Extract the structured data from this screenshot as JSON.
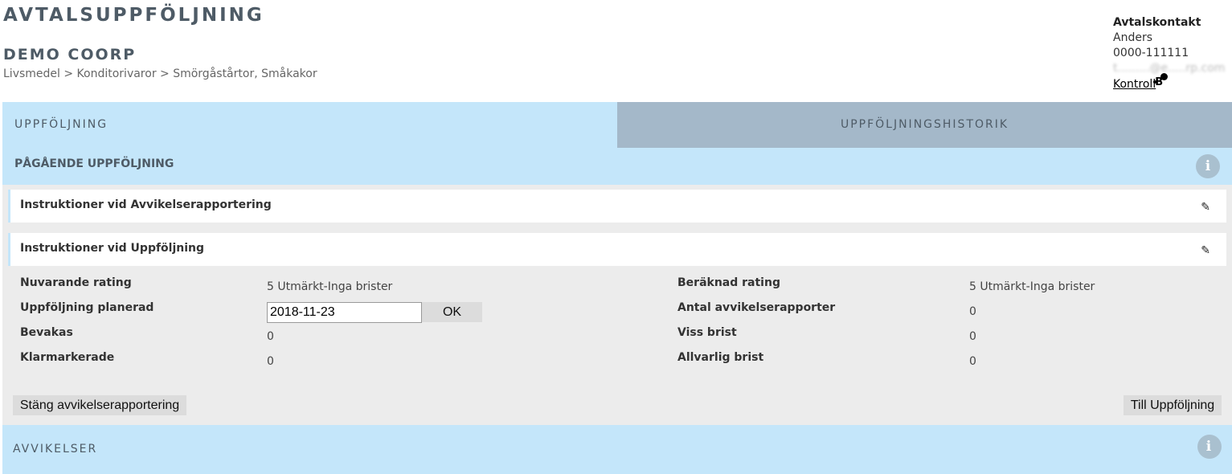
{
  "header": {
    "title": "AVTALSUPPFÖLJNING",
    "company": "DEMO COORP",
    "breadcrumb": "Livsmedel > Konditorivaror > Smörgåstårtor, Småkakor"
  },
  "contact": {
    "title": "Avtalskontakt",
    "name": "Anders",
    "phone": "0000-111111",
    "email": "t.........@e.....rp.com",
    "link": "Kontroll",
    "marker": "B"
  },
  "tabs": {
    "active": "UPPFÖLJNING",
    "history": "UPPFÖLJNINGSHISTORIK"
  },
  "section": {
    "ongoing": "PÅGÅENDE UPPFÖLJNING",
    "info_icon": "i",
    "deviations": "AVVIKELSER"
  },
  "instructions": {
    "deviation": "Instruktioner vid Avvikelserapportering",
    "followup": "Instruktioner vid Uppföljning",
    "edit_icon": "✎"
  },
  "fields": {
    "current_rating": {
      "label": "Nuvarande rating",
      "value": "5 Utmärkt-Inga brister"
    },
    "planned": {
      "label": "Uppföljning planerad",
      "value": "2018-11-23",
      "button": "OK"
    },
    "watching": {
      "label": "Bevakas",
      "value": "0"
    },
    "cleared": {
      "label": "Klarmarkerade",
      "value": "0"
    },
    "calc_rating": {
      "label": "Beräknad rating",
      "value": "5 Utmärkt-Inga brister"
    },
    "reports": {
      "label": "Antal avvikelserapporter",
      "value": "0"
    },
    "some_issue": {
      "label": "Viss brist",
      "value": "0"
    },
    "serious_issue": {
      "label": "Allvarlig brist",
      "value": "0"
    }
  },
  "buttons": {
    "close_reporting": "Stäng avvikelserapportering",
    "to_followup": "Till Uppföljning"
  },
  "colors": {
    "light_blue": "#c4e6fa",
    "gray_blue": "#a4b8c9",
    "panel_gray": "#ececec"
  }
}
